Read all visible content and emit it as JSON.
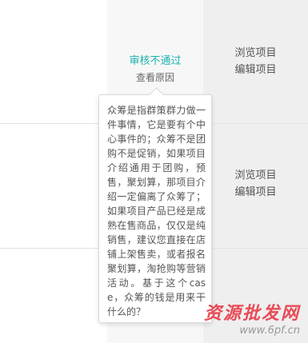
{
  "rows": [
    {
      "status": "审核不通过",
      "status_color": "#1fb3b0",
      "reason_link": "查看原因",
      "actions": [
        "浏览项目",
        "编辑项目"
      ]
    },
    {
      "actions": [
        "浏览项目",
        "编辑项目"
      ]
    }
  ],
  "tooltip": {
    "text": "众筹是指群策群力做一件事情，它是要有个中心事件的；众筹不是团购不是促销，如果项目介绍通用于团购，预售，聚划算，那项目介绍一定偏离了众筹了；如果项目产品已经是成熟在售商品，仅仅是纯销售，建议您直接在店铺上架售卖，或者报名聚划算，淘抢购等营销活动。基于这个case，众筹的钱是用来干什么的？"
  },
  "watermark": {
    "main": "资源批发网",
    "url": "www.6pf.cn"
  },
  "colors": {
    "accent": "#1fb3b0",
    "watermark": "#e84b57"
  }
}
